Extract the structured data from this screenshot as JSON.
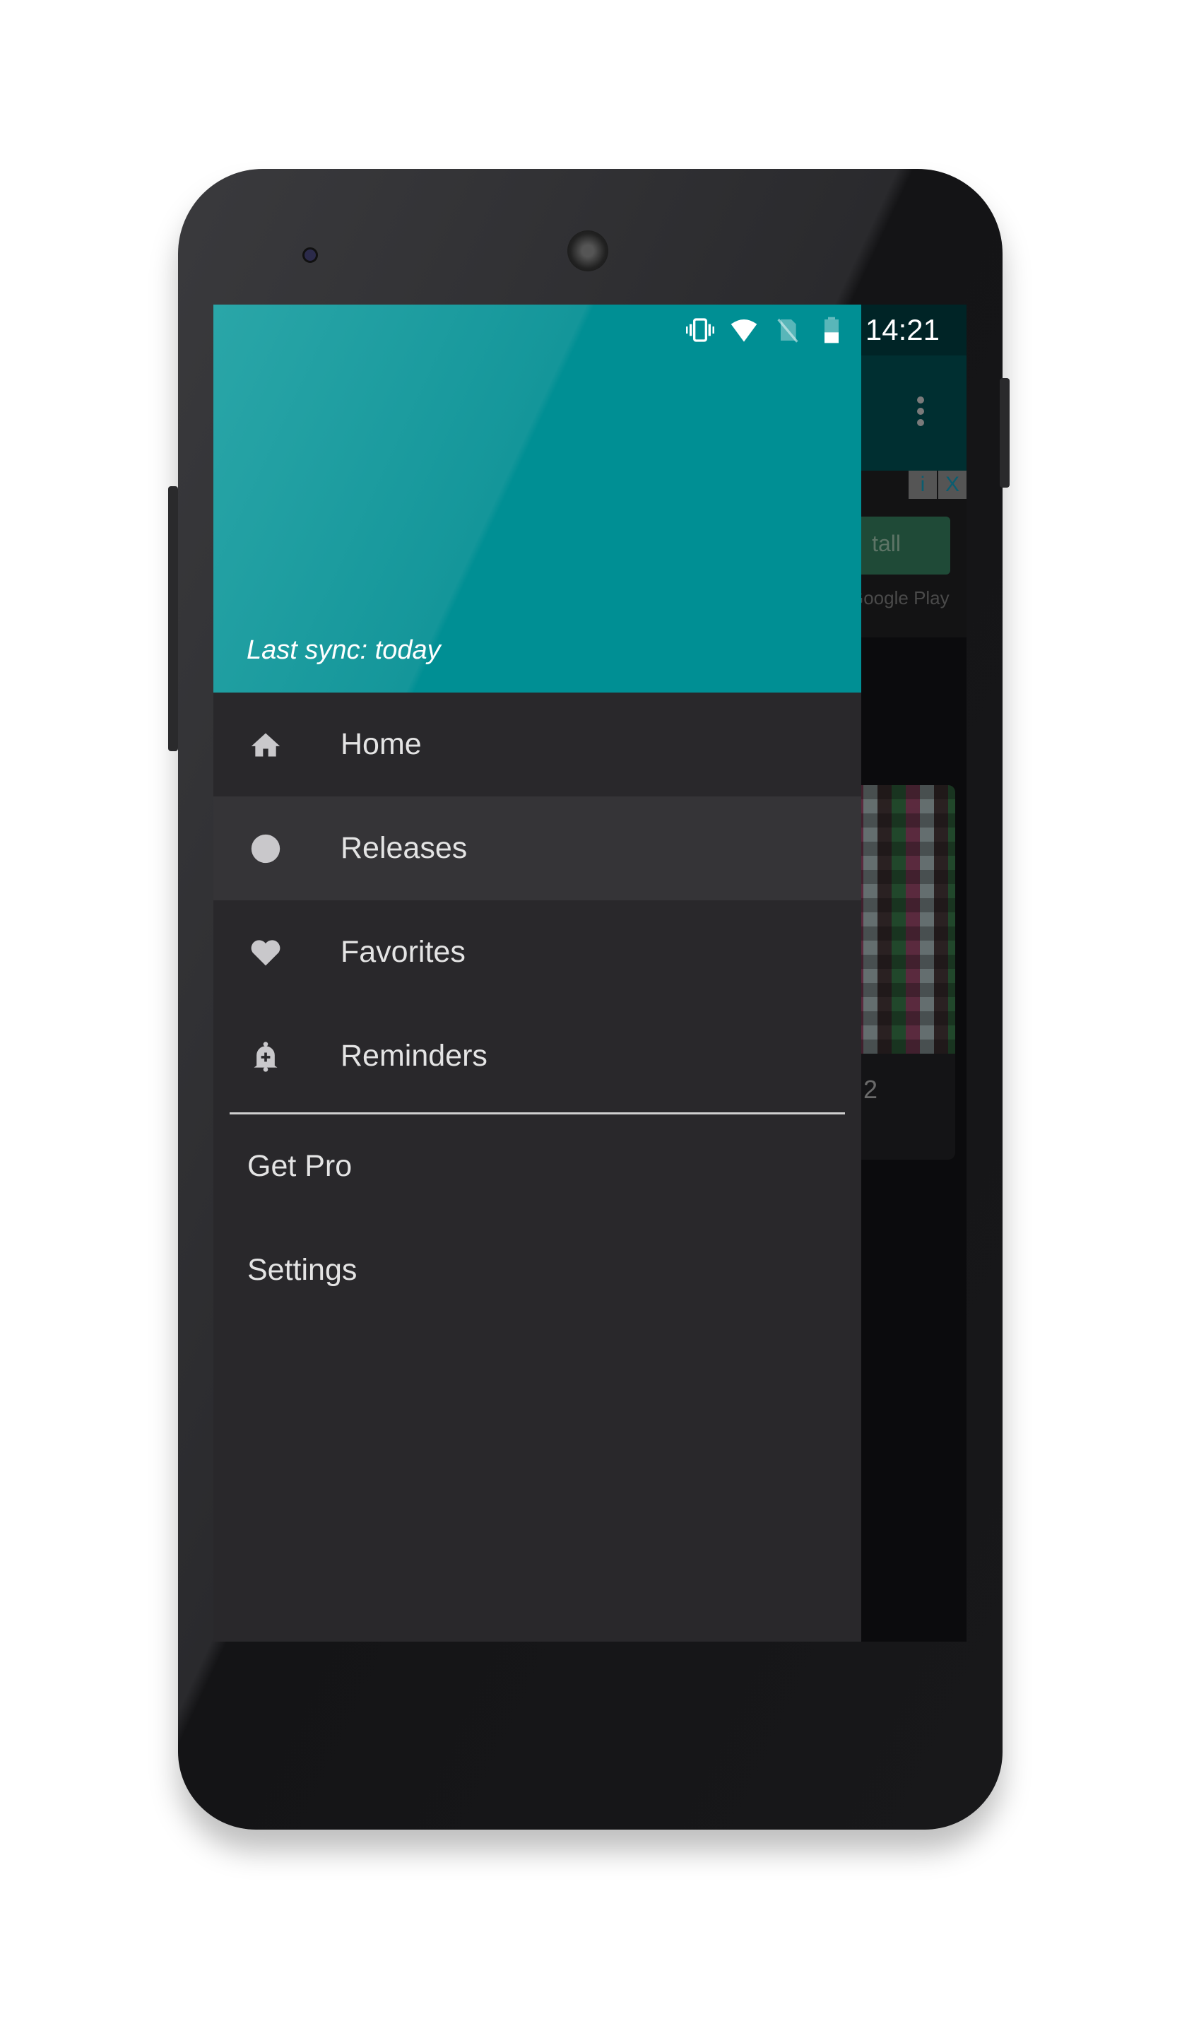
{
  "status_bar": {
    "time": "14:21",
    "icons": [
      "vibrate-icon",
      "wifi-icon",
      "no-sim-icon",
      "battery-icon"
    ]
  },
  "drawer": {
    "header": {
      "sync_text": "Last sync: today",
      "color": "#008f94"
    },
    "items": [
      {
        "label": "Home",
        "icon": "home-icon",
        "active": false
      },
      {
        "label": "Releases",
        "icon": "circle-icon",
        "active": true
      },
      {
        "label": "Favorites",
        "icon": "heart-icon",
        "active": false
      },
      {
        "label": "Reminders",
        "icon": "bell-plus-icon",
        "active": false
      }
    ],
    "secondary": [
      {
        "label": "Get Pro"
      },
      {
        "label": "Settings"
      }
    ]
  },
  "background": {
    "ad_button": "tall",
    "ad_source": "Google Play",
    "ad_info": "i",
    "ad_close": "X",
    "card_number": "2"
  }
}
